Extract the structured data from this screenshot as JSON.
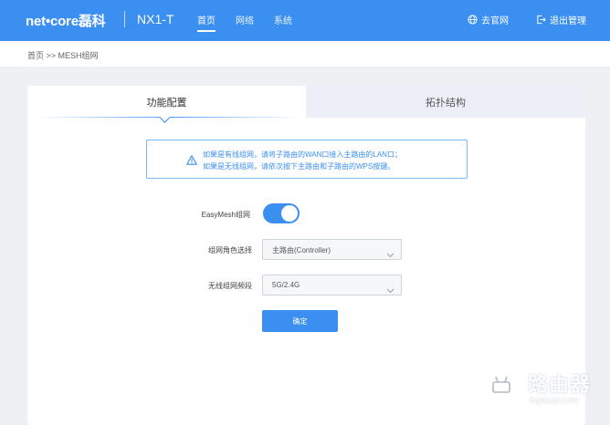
{
  "header": {
    "logo_text": "net•core磊科",
    "model": "NX1-T",
    "nav": [
      "首页",
      "网络",
      "系统"
    ],
    "nav_active": 0,
    "go_official_label": "去官网",
    "logout_label": "退出管理"
  },
  "breadcrumb": "首页 >> MESH组网",
  "tabs": {
    "config": "功能配置",
    "topology": "拓扑结构"
  },
  "notice": {
    "line1": "如果是有线组网，请将子路由的WAN口接入主路由的LAN口；",
    "line2": "如果是无线组网，请依次按下主路由和子路由的WPS按键。"
  },
  "form": {
    "easymesh_label": "EasyMesh组网",
    "easymesh_enabled": true,
    "role_label": "组网角色选择",
    "role_value": "主路由(Controller)",
    "band_label": "无线组网频段",
    "band_value": "5G/2.4G",
    "confirm_label": "确定"
  },
  "watermark": {
    "title": "路由器",
    "subtitle": "luyouqi.com"
  },
  "colors": {
    "primary": "#3a8ff0",
    "background": "#eef0f4",
    "tab_inactive": "#eceef8"
  }
}
